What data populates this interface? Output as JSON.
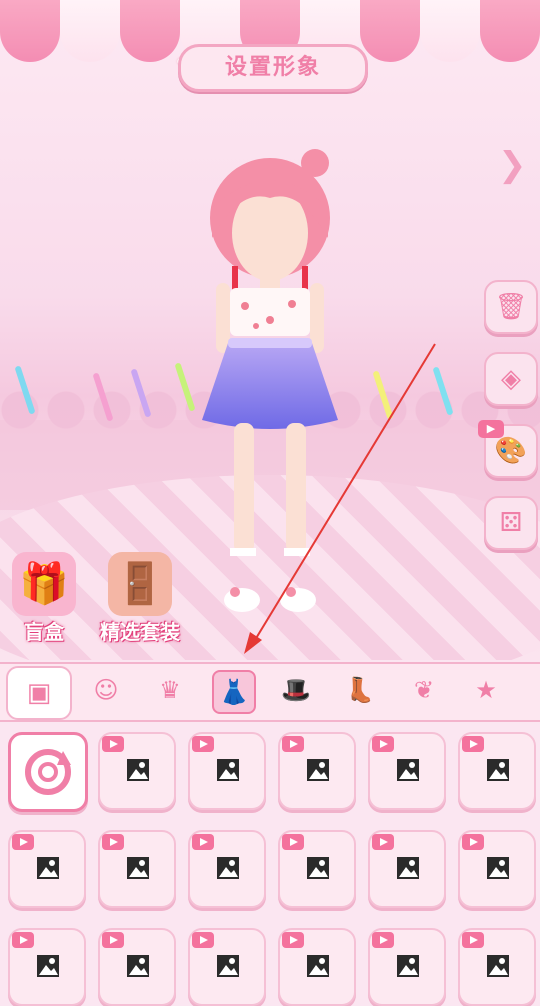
{
  "header": {
    "title": "设置形象"
  },
  "promos": [
    {
      "label": "盲盒",
      "icon": "gift-box-icon"
    },
    {
      "label": "精选套装",
      "icon": "wardrobe-icon"
    }
  ],
  "side_buttons": [
    {
      "name": "trash-button",
      "icon": "trash-icon",
      "glyph": "🗑"
    },
    {
      "name": "layers-button",
      "icon": "layers-icon",
      "glyph": "◈"
    },
    {
      "name": "palette-button",
      "icon": "palette-icon",
      "glyph": "🎨",
      "ad": true
    },
    {
      "name": "dice-button",
      "icon": "dice-icon",
      "glyph": "⚄"
    }
  ],
  "tabs": [
    {
      "name": "tab-face",
      "glyph": "☺"
    },
    {
      "name": "tab-hair",
      "glyph": "♛"
    },
    {
      "name": "tab-dress",
      "glyph": "👗",
      "active": true
    },
    {
      "name": "tab-hat",
      "glyph": "🎩"
    },
    {
      "name": "tab-shoes",
      "glyph": "👢"
    },
    {
      "name": "tab-wings",
      "glyph": "❦"
    },
    {
      "name": "tab-star",
      "glyph": "★"
    }
  ],
  "colors": {
    "accent": "#f07fa7",
    "badge": "#f4729d",
    "background": "#fbe6f1"
  }
}
